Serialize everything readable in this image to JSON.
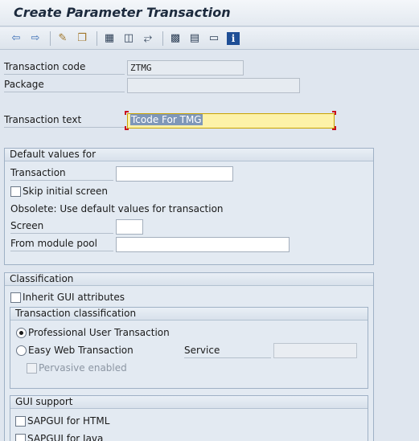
{
  "title": "Create Parameter Transaction",
  "toolbar": {
    "icons": [
      "arrow-left-icon",
      "arrow-right-icon",
      "display-change-icon",
      "other-object-icon",
      "object-list-icon",
      "hierarchy-icon",
      "navigation-icon",
      "where-used-icon",
      "transport-icon",
      "layout-icon",
      "info-icon"
    ]
  },
  "header": {
    "transaction_code_label": "Transaction code",
    "transaction_code_value": "ZTMG",
    "package_label": "Package",
    "package_value": "",
    "transaction_text_label": "Transaction text",
    "transaction_text_value": "Tcode For TMG"
  },
  "default_values": {
    "title": "Default values for",
    "transaction_label": "Transaction",
    "transaction_value": "",
    "skip_initial_screen_label": "Skip initial screen",
    "skip_initial_screen_checked": false,
    "obsolete_text": "Obsolete: Use default values for transaction",
    "screen_label": "Screen",
    "screen_value": "",
    "module_pool_label": "From module pool",
    "module_pool_value": ""
  },
  "classification": {
    "title": "Classification",
    "inherit_gui_label": "Inherit GUI attributes",
    "inherit_gui_checked": false,
    "transaction_classification": {
      "title": "Transaction classification",
      "professional_label": "Professional User Transaction",
      "professional_selected": true,
      "easy_web_label": "Easy Web Transaction",
      "easy_web_selected": false,
      "service_label": "Service",
      "service_value": "",
      "pervasive_label": "Pervasive enabled",
      "pervasive_checked": false
    },
    "gui_support": {
      "title": "GUI support",
      "sapgui_html_label": "SAPGUI for HTML",
      "sapgui_java_label": "SAPGUI for Java"
    }
  },
  "colors": {
    "background": "#dfe6ef",
    "highlight_field": "#fdf2a8",
    "required_marker": "#c8101e",
    "toolbar_icon": "#3a6db5"
  }
}
